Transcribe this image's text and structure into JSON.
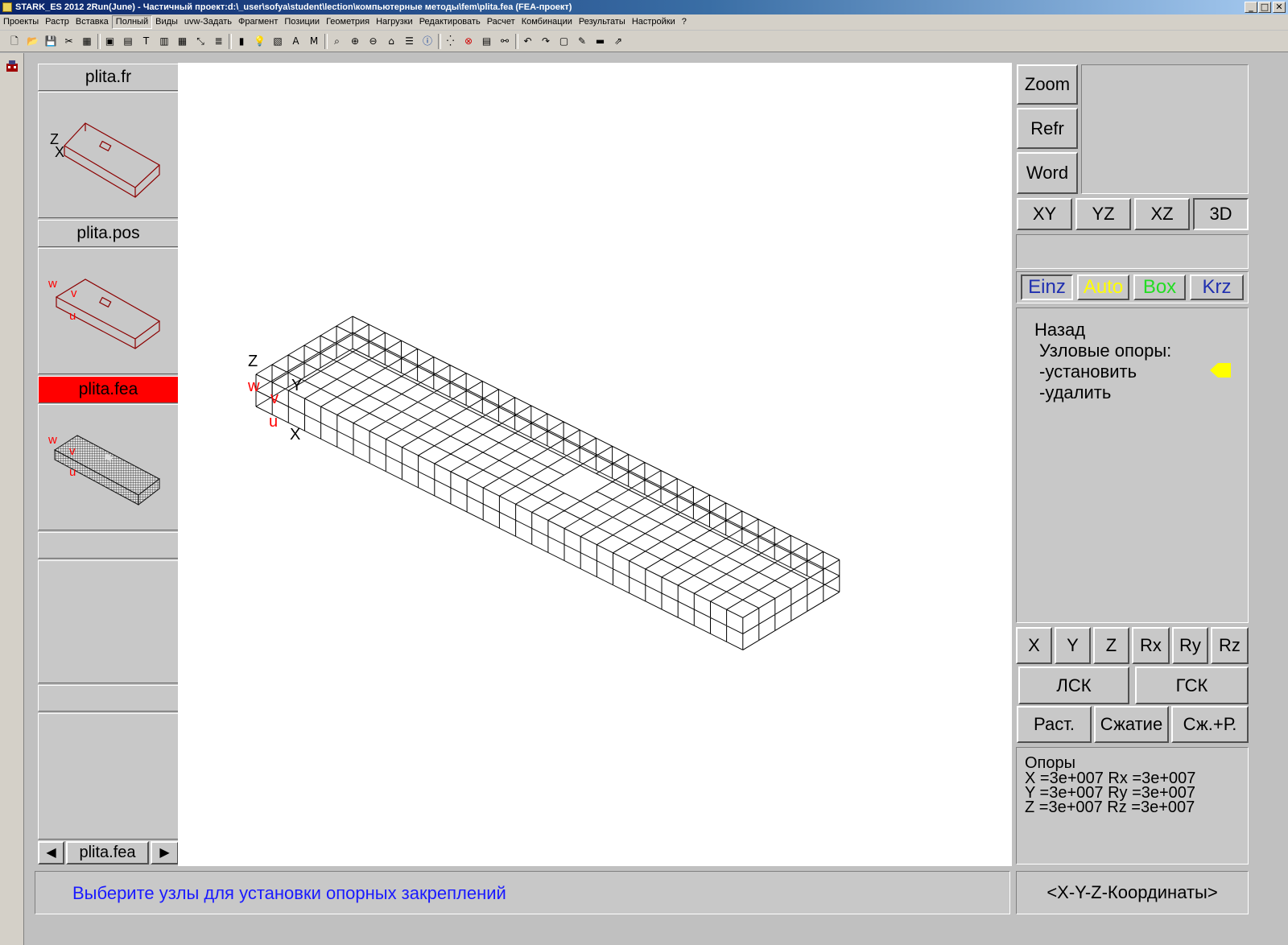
{
  "window": {
    "title": "STARK_ES 2012 2Run(June) - Частичный проект:d:\\_user\\sofya\\student\\lection\\компьютерные методы\\fem\\plita.fea  (FEA-проект)",
    "minimize": "_",
    "maximize": "□",
    "close": "✕"
  },
  "menu": {
    "items": [
      "Проекты",
      "Растр",
      "Вставка",
      "Полный",
      "Виды",
      "uvw-Задать",
      "Фрагмент",
      "Позиции",
      "Геометрия",
      "Нагрузки",
      "Редактировать",
      "Расчет",
      "Комбинации",
      "Результаты",
      "Настройки",
      "?"
    ],
    "active_index": 3
  },
  "toolbar": {
    "icons": [
      "new-file-icon",
      "open-folder-icon",
      "save-icon",
      "cut-icon",
      "grid-icon",
      "frame-icon",
      "model-icon",
      "text-icon",
      "mesh-icon",
      "grid2-icon",
      "axes-icon",
      "layers-icon",
      "cylinder-icon",
      "bulb-icon",
      "hatch-icon",
      "label-icon",
      "m-icon",
      "zoom-icon",
      "zoom-in-icon",
      "zoom-out-icon",
      "house-icon",
      "properties-icon",
      "info-icon",
      "nodes-icon",
      "stop-icon",
      "table-icon",
      "network-icon",
      "undo-icon",
      "redo-icon",
      "box-icon",
      "pencil-icon",
      "ruler-icon",
      "export-icon"
    ]
  },
  "left_panel": {
    "thumbnails": [
      {
        "label": "plita.fr",
        "active": false
      },
      {
        "label": "plita.pos",
        "active": false
      },
      {
        "label": "plita.fea",
        "active": true
      }
    ],
    "nav": {
      "prev": "◀",
      "current": "plita.fea",
      "next": "▶"
    },
    "active_color": "#ff0000"
  },
  "viewport": {
    "axes": {
      "x": "X",
      "y": "Y",
      "z": "Z",
      "u": "u",
      "v": "v",
      "w": "w"
    },
    "axis_color_local": "#ff0000",
    "mesh_color": "#000000",
    "thumb_wire_color": "#8b0000"
  },
  "right_panel": {
    "view_buttons": [
      "Zoom",
      "Refr",
      "Word"
    ],
    "projection_buttons": [
      "XY",
      "YZ",
      "XZ",
      "3D"
    ],
    "projection_active": "3D",
    "select_modes": [
      {
        "label": "Einz",
        "color": "#1f2fb0"
      },
      {
        "label": "Auto",
        "color": "#ffff00"
      },
      {
        "label": "Box",
        "color": "#22dd22"
      },
      {
        "label": "Krz",
        "color": "#1f2fb0"
      }
    ],
    "menu": {
      "back": "Назад",
      "heading": "Узловые опоры:",
      "items": [
        "-установить",
        "-удалить"
      ],
      "pointer_color": "#ffff00"
    },
    "dof_buttons": [
      "X",
      "Y",
      "Z",
      "Rx",
      "Ry",
      "Rz"
    ],
    "cs_buttons": [
      "ЛСК",
      "ГСК"
    ],
    "mode_buttons": [
      "Раст.",
      "Сжатие",
      "Сж.+Р."
    ],
    "supports": {
      "title": "Опоры",
      "lines": [
        "X =3e+007 Rx =3e+007",
        "Y =3e+007 Ry =3e+007",
        "Z =3e+007 Rz =3e+007"
      ]
    }
  },
  "status": {
    "message": "Выберите узлы для установки опорных закреплений",
    "message_color": "#1a1aff",
    "coords": "<X-Y-Z-Координаты>"
  }
}
